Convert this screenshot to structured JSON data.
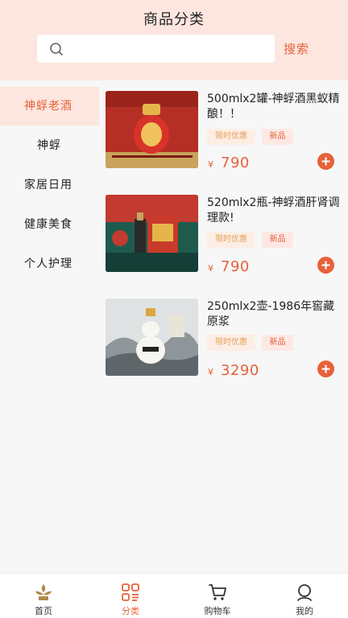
{
  "header": {
    "title": "商品分类",
    "search_placeholder": "",
    "search_button": "搜索"
  },
  "sidebar": {
    "items": [
      {
        "label": "神蜉老酒",
        "active": true
      },
      {
        "label": "神蜉",
        "active": false
      },
      {
        "label": "家居日用",
        "active": false
      },
      {
        "label": "健康美食",
        "active": false
      },
      {
        "label": "个人护理",
        "active": false
      }
    ]
  },
  "products": [
    {
      "title": "500mlx2罐-神蜉酒黑蚁精酿！！",
      "tag_promo": "限时优惠",
      "tag_new": "新品",
      "currency": "¥",
      "price": "790"
    },
    {
      "title": "520mlx2瓶-神蜉酒肝肾调理款!",
      "tag_promo": "限时优惠",
      "tag_new": "新品",
      "currency": "¥",
      "price": "790"
    },
    {
      "title": "250mlx2壶-1986年窖藏原浆",
      "tag_promo": "限时优惠",
      "tag_new": "新品",
      "currency": "¥",
      "price": "3290"
    }
  ],
  "tabbar": {
    "items": [
      {
        "label": "首页",
        "icon": "home-logo-icon"
      },
      {
        "label": "分类",
        "icon": "category-icon",
        "active": true
      },
      {
        "label": "购物车",
        "icon": "cart-icon"
      },
      {
        "label": "我的",
        "icon": "user-icon"
      }
    ]
  },
  "colors": {
    "accent": "#e8613a",
    "header_bg": "#fde6df",
    "promo_text": "#e3a159"
  }
}
